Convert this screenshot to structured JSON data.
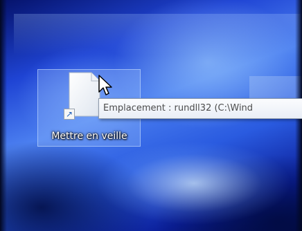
{
  "desktop": {
    "icon": {
      "label": "Mettre en veille",
      "icon_name": "document-shortcut-icon",
      "overlay_icon": "shortcut-arrow-icon"
    },
    "tooltip": {
      "text": "Emplacement : rundll32 (C:\\Wind"
    },
    "cursor": {
      "icon_name": "arrow-pointer-icon"
    }
  }
}
